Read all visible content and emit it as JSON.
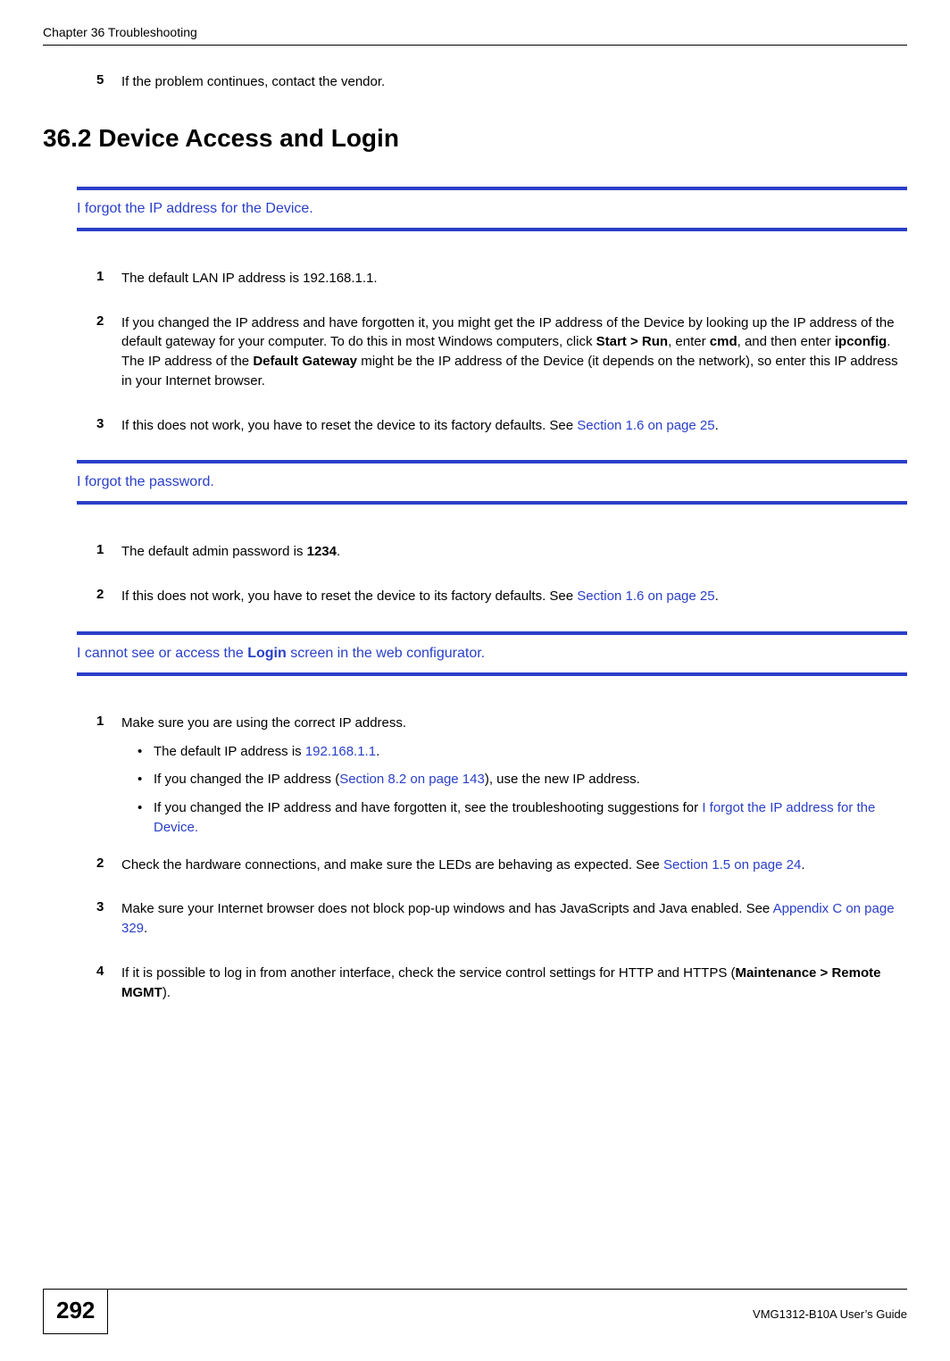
{
  "header": {
    "chapter": "Chapter 36 Troubleshooting"
  },
  "pre_step": {
    "num": "5",
    "text": "If the problem continues, contact the vendor."
  },
  "section_heading": "36.2  Device Access and Login",
  "issues": [
    {
      "title_plain": "I forgot the IP address for the Device."
    },
    {
      "title_plain": "I forgot the password."
    },
    {
      "title_prefix": "I cannot see or access the ",
      "title_bold": "Login",
      "title_suffix": " screen in the web configurator."
    }
  ],
  "issue1_steps": {
    "s1": {
      "num": "1",
      "text": "The default LAN IP address is 192.168.1.1."
    },
    "s2": {
      "num": "2",
      "t1": "If you changed the IP address and have forgotten it, you might get the IP address of the Device by looking up the IP address of the default gateway for your computer. To do this in most Windows computers, click ",
      "b1": "Start > Run",
      "t2": ", enter ",
      "b2": "cmd",
      "t3": ", and then enter ",
      "b3": "ipconfig",
      "t4": ". The IP address of the ",
      "b4": "Default Gateway",
      "t5": " might be the IP address of the Device (it depends on the network), so enter this IP address in your Internet browser."
    },
    "s3": {
      "num": "3",
      "t1": "If this does not work, you have to reset the device to its factory defaults. See ",
      "link": "Section 1.6 on page 25",
      "t2": "."
    }
  },
  "issue2_steps": {
    "s1": {
      "num": "1",
      "t1": "The default admin password is ",
      "b1": "1234",
      "t2": "."
    },
    "s2": {
      "num": "2",
      "t1": "If this does not work, you have to reset the device to its factory defaults. See ",
      "link": "Section 1.6 on page 25",
      "t2": "."
    }
  },
  "issue3_steps": {
    "s1": {
      "num": "1",
      "text": "Make sure you are using the correct IP address.",
      "bullets": {
        "b1": {
          "t1": "The default IP address is ",
          "link": "192.168.1.1",
          "t2": "."
        },
        "b2": {
          "t1": "If you changed the IP address (",
          "link": "Section 8.2 on page 143",
          "t2": "), use the new IP address."
        },
        "b3": {
          "t1": "If you changed the IP address and have forgotten it, see the troubleshooting suggestions for ",
          "link": "I forgot the IP address for the Device."
        }
      }
    },
    "s2": {
      "num": "2",
      "t1": "Check the hardware connections, and make sure the LEDs are behaving as expected. See ",
      "link": "Section 1.5 on page 24",
      "t2": "."
    },
    "s3": {
      "num": "3",
      "t1": "Make sure your Internet browser does not block pop-up windows and has JavaScripts and Java enabled. See ",
      "link": "Appendix C on page 329",
      "t2": "."
    },
    "s4": {
      "num": "4",
      "t1": "If it is possible to log in from another interface, check the service control settings for HTTP and HTTPS (",
      "b1": "Maintenance > Remote MGMT",
      "t2": ")."
    }
  },
  "footer": {
    "page_num": "292",
    "guide": "VMG1312-B10A User’s Guide"
  }
}
